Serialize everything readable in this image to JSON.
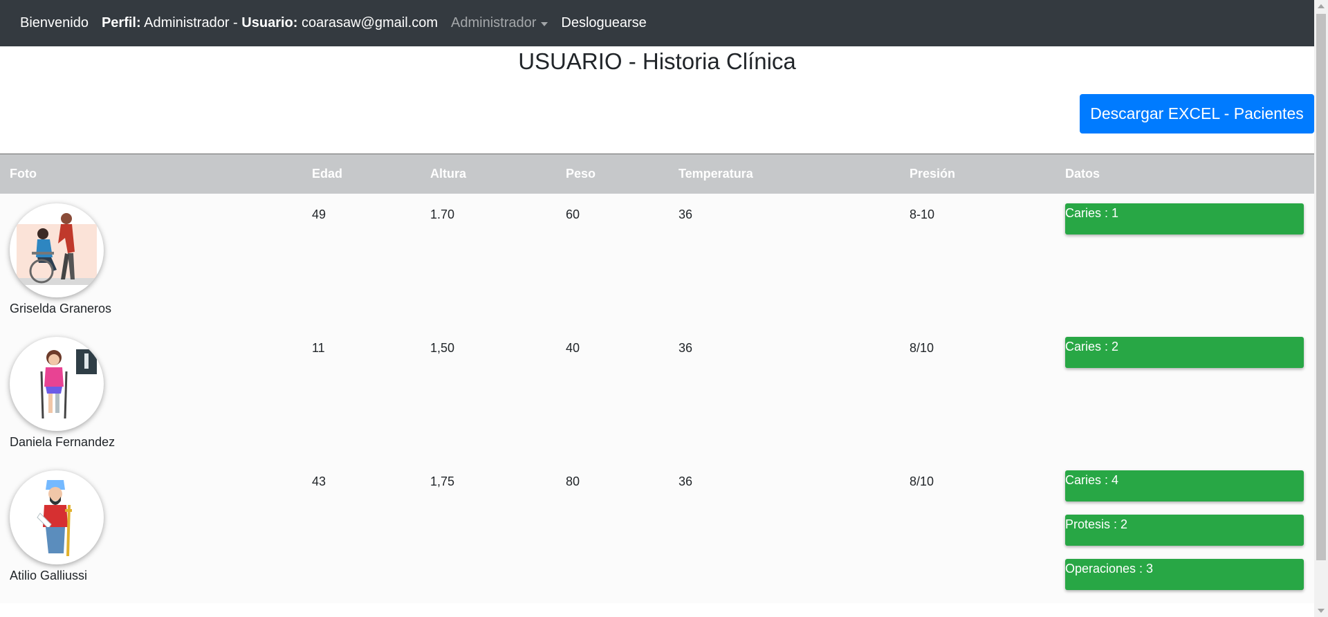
{
  "nav": {
    "welcome": "Bienvenido",
    "profile_label": "Perfil:",
    "profile_value": "Administrador -",
    "user_label": "Usuario:",
    "user_value": "coarasaw@gmail.com",
    "dropdown": "Administrador",
    "logout": "Desloguearse"
  },
  "page": {
    "title": "USUARIO - Historia Clínica",
    "download_button": "Descargar EXCEL - Pacientes"
  },
  "table": {
    "headers": [
      "Foto",
      "Edad",
      "Altura",
      "Peso",
      "Temperatura",
      "Presión",
      "Datos"
    ],
    "rows": [
      {
        "name": "Griselda Graneros",
        "edad": "49",
        "altura": "1.70",
        "peso": "60",
        "temperatura": "36",
        "presion": "8-10",
        "datos": [
          "Caries : 1"
        ]
      },
      {
        "name": "Daniela Fernandez",
        "edad": "11",
        "altura": "1,50",
        "peso": "40",
        "temperatura": "36",
        "presion": "8/10",
        "datos": [
          "Caries : 2"
        ]
      },
      {
        "name": "Atilio Galliussi",
        "edad": "43",
        "altura": "1,75",
        "peso": "80",
        "temperatura": "36",
        "presion": "8/10",
        "datos": [
          "Caries : 4",
          "Protesis : 2",
          "Operaciones : 3"
        ]
      }
    ]
  },
  "colors": {
    "navbar": "#343a40",
    "primary": "#007bff",
    "success": "#28a745",
    "table_header": "#c6c8ca"
  },
  "icons": [
    "wheelchair-patient-avatar",
    "crutches-girl-avatar",
    "injured-man-avatar",
    "caret-down-icon"
  ]
}
